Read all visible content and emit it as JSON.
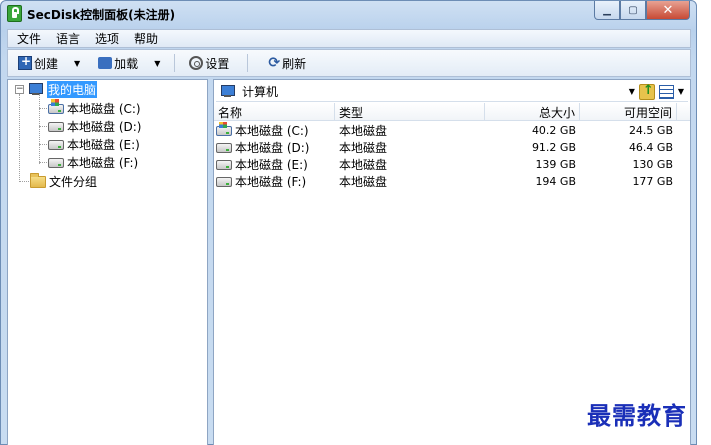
{
  "window": {
    "title": "SecDisk控制面板(未注册)"
  },
  "menu": {
    "items": [
      "文件",
      "语言",
      "选项",
      "帮助"
    ]
  },
  "toolbar": {
    "create": "创建",
    "load": "加载",
    "settings": "设置",
    "refresh": "刷新"
  },
  "tree": {
    "root": "我的电脑",
    "drives": [
      "本地磁盘 (C:)",
      "本地磁盘 (D:)",
      "本地磁盘 (E:)",
      "本地磁盘 (F:)"
    ],
    "group": "文件分组"
  },
  "address": {
    "text": "计算机"
  },
  "list": {
    "headers": {
      "name": "名称",
      "type": "类型",
      "total": "总大小",
      "free": "可用空间"
    },
    "rows": [
      {
        "name": "本地磁盘 (C:)",
        "type": "本地磁盘",
        "total": "40.2 GB",
        "free": "24.5 GB"
      },
      {
        "name": "本地磁盘 (D:)",
        "type": "本地磁盘",
        "total": "91.2 GB",
        "free": "46.4 GB"
      },
      {
        "name": "本地磁盘 (E:)",
        "type": "本地磁盘",
        "total": "139 GB",
        "free": "130 GB"
      },
      {
        "name": "本地磁盘 (F:)",
        "type": "本地磁盘",
        "total": "194 GB",
        "free": "177 GB"
      }
    ]
  },
  "watermark": "最需教育"
}
